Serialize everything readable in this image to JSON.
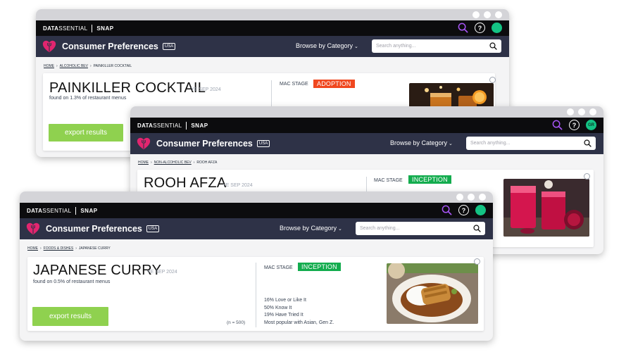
{
  "brand": {
    "data": "DATA",
    "essential": "SSENTIAL",
    "snap": "SNAP"
  },
  "nav": {
    "title": "Consumer Preferences",
    "region": "USA",
    "browse_label": "Browse by Category",
    "search_placeholder": "Search anything..."
  },
  "colors": {
    "topbar": "#0c0c0e",
    "navbar": "#2e3247",
    "accent_logo": "#e2256f",
    "search_icon": "#a855f7",
    "avatar": "#14c384",
    "export_button": "#8fd14f",
    "adoption_badge": "#f0471f",
    "inception_badge": "#13ac4e"
  },
  "icons": [
    "heart-fork-logo-icon",
    "search-icon",
    "help-icon",
    "avatar-icon",
    "magnifier-icon",
    "chevron-down-icon",
    "radio-icon"
  ],
  "windows": [
    {
      "breadcrumb": {
        "home": "HOME",
        "category": "ALCOHOLIC BEV",
        "current": "PAINKILLER COCKTAIL"
      },
      "item": "PAINKILLER COCKTAIL",
      "ye": "YE SEP 2024",
      "found": "found on 1.3% of restaurant menus",
      "mac_label": "MAC STAGE",
      "mac_stage": "ADOPTION",
      "export_label": "export results"
    },
    {
      "avatar_initials": "GR",
      "breadcrumb": {
        "home": "HOME",
        "category": "NON-ALCOHOLIC BEV",
        "current": "ROOH AFZA"
      },
      "item": "ROOH AFZA",
      "ye": "YE SEP 2024",
      "mac_label": "MAC STAGE",
      "mac_stage": "INCEPTION"
    },
    {
      "breadcrumb": {
        "home": "HOME",
        "category": "FOODS & DISHES",
        "current": "JAPANESE CURRY"
      },
      "item": "JAPANESE CURRY",
      "ye": "YE SEP 2024",
      "found": "found on 0.5% of restaurant menus",
      "mac_label": "MAC STAGE",
      "mac_stage": "INCEPTION",
      "export_label": "export results",
      "sample": "(n = 500)",
      "stats": [
        "16% Love or Like It",
        "50% Know It",
        "19% Have Tried It",
        "Most popular with Asian, Gen Z."
      ]
    }
  ]
}
